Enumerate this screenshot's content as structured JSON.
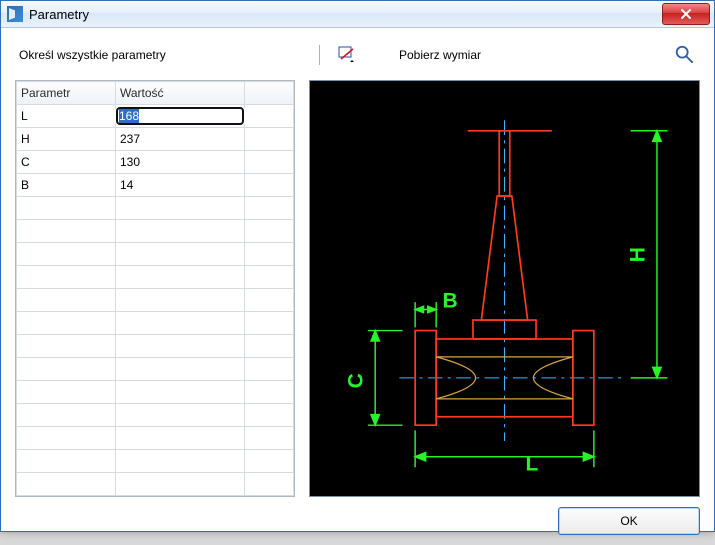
{
  "window": {
    "title": "Parametry"
  },
  "instruction": "Określ wszystkie parametry",
  "toolbar": {
    "pick_label": "Pobierz wymiar"
  },
  "table": {
    "headers": {
      "param": "Parametr",
      "value": "Wartość",
      "extra": ""
    },
    "rows": [
      {
        "name": "L",
        "value": "168",
        "editing": true
      },
      {
        "name": "H",
        "value": "237",
        "editing": false
      },
      {
        "name": "C",
        "value": "130",
        "editing": false
      },
      {
        "name": "B",
        "value": "14",
        "editing": false
      }
    ]
  },
  "drawing": {
    "labels": {
      "L": "L",
      "H": "H",
      "C": "C",
      "B": "B"
    },
    "colors": {
      "part": "#ff3a1e",
      "dim": "#28f228",
      "center": "#3ab6ff",
      "hidden": "#d9a441"
    }
  },
  "buttons": {
    "ok": "OK"
  }
}
